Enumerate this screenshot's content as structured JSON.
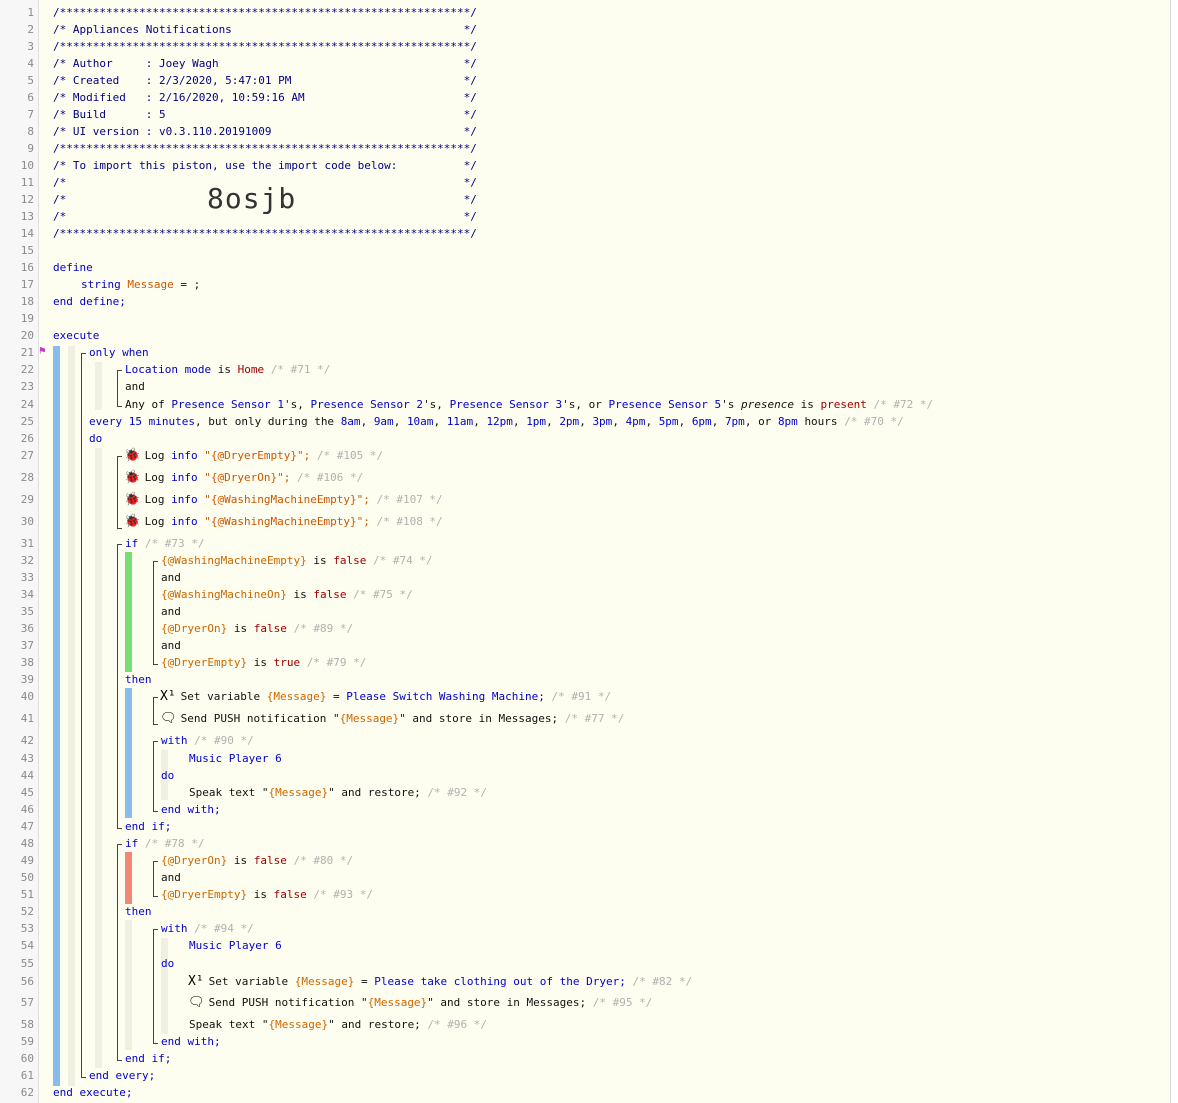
{
  "piston": {
    "header": [
      "/**************************************************************/",
      "/* Appliances Notifications                                   */",
      "/**************************************************************/",
      "/* Author     : Joey Wagh                                     */",
      "/* Created    : 2/3/2020, 5:47:01 PM                          */",
      "/* Modified   : 2/16/2020, 10:59:16 AM                        */",
      "/* Build      : 5                                             */",
      "/* UI version : v0.3.110.20191009                             */",
      "/**************************************************************/",
      "/* To import this piston, use the import code below:          */",
      "/*                                                            */",
      "/*                                                            */",
      "/*                                                            */",
      "/**************************************************************/"
    ],
    "import_code": "8osjb"
  },
  "line_numbers": [
    "1",
    "2",
    "3",
    "4",
    "5",
    "6",
    "7",
    "8",
    "9",
    "10",
    "11",
    "12",
    "13",
    "14",
    "15",
    "16",
    "17",
    "18",
    "19",
    "20",
    "21",
    "22",
    "23",
    "24",
    "25",
    "26",
    "27",
    "28",
    "29",
    "30",
    "31",
    "32",
    "33",
    "34",
    "35",
    "36",
    "37",
    "38",
    "39",
    "40",
    "41",
    "42",
    "43",
    "44",
    "45",
    "46",
    "47",
    "48",
    "49",
    "50",
    "51",
    "52",
    "53",
    "54",
    "55",
    "56",
    "57",
    "58",
    "59",
    "60",
    "61",
    "62"
  ],
  "code": {
    "define": "define",
    "string_kw": "string",
    "message_var": "Message",
    "assign_tail": " = ;",
    "end_define": "end define;",
    "execute": "execute",
    "only_when": "only when",
    "location_mode": "Location mode",
    "is": "is",
    "home": "Home",
    "c71": "/* #71 */",
    "and": "and",
    "any_of": "Any of",
    "ps1": "Presence Sensor 1",
    "ps2": "Presence Sensor 2",
    "ps3": "Presence Sensor 3",
    "ps5": "Presence Sensor 5",
    "apos_s_comma": "'s,",
    "apos_s_comma_or": "'s, or",
    "apos_s": "'s",
    "presence": "presence",
    "present": "present",
    "c72": "/* #72 */",
    "every": "every",
    "fifteen_minutes": "15 minutes",
    "but_only": ", but only during the",
    "hours_list": [
      "8am",
      "9am",
      "10am",
      "11am",
      "12pm",
      "1pm",
      "2pm",
      "3pm",
      "4pm",
      "5pm",
      "6pm",
      "7pm"
    ],
    "or": "or",
    "eight_pm": "8pm",
    "hours_word": "hours",
    "c70": "/* #70 */",
    "do": "do",
    "log": "Log",
    "info": "info",
    "log1": "\"{@DryerEmpty}\";",
    "log2": "\"{@DryerOn}\";",
    "log3": "\"{@WashingMachineEmpty}\";",
    "log4": "\"{@WashingMachineEmpty}\";",
    "c105": "/* #105 */",
    "c106": "/* #106 */",
    "c107": "/* #107 */",
    "c108": "/* #108 */",
    "if": "if",
    "c73": "/* #73 */",
    "wme": "{@WashingMachineEmpty}",
    "wmon": "{@WashingMachineOn}",
    "dryeron": "{@DryerOn}",
    "dryerempty": "{@DryerEmpty}",
    "false": "false",
    "true": "true",
    "c74": "/* #74 */",
    "c75": "/* #75 */",
    "c89": "/* #89 */",
    "c79": "/* #79 */",
    "then": "then",
    "set_variable": "Set variable",
    "msg_expr": "{Message}",
    "eq": "=",
    "msg_wash": "Please Switch Washing Machine;",
    "c91": "/* #91 */",
    "send_push": "Send PUSH notification \"",
    "send_push_tail": "\" and store in Messages;",
    "c77": "/* #77 */",
    "with": "with",
    "c90": "/* #90 */",
    "music_player": "Music Player 6",
    "speak_text": "Speak text \"",
    "and_restore": "\" and restore;",
    "c92": "/* #92 */",
    "end_with": "end with;",
    "end_if": "end if;",
    "c78": "/* #78 */",
    "c80": "/* #80 */",
    "c93": "/* #93 */",
    "c94": "/* #94 */",
    "msg_dryer": "Please take clothing out of the Dryer;",
    "c82": "/* #82 */",
    "c95": "/* #95 */",
    "c96": "/* #96 */",
    "end_every": "end every;",
    "end_execute": "end execute;"
  },
  "colors": {
    "keyword": "#0000cc",
    "variable": "#cc5500",
    "value": "#a00000",
    "comment": "#b0b0b0",
    "bar_blue": "#88bbee",
    "bar_green": "#77dd77",
    "bar_red": "#f08878",
    "bar_cream": "#f0f0e0"
  },
  "icons": {
    "log": "bug-icon",
    "set_variable": "x-one-icon",
    "push": "speech-bubble-icon",
    "flag": "flag-icon"
  }
}
